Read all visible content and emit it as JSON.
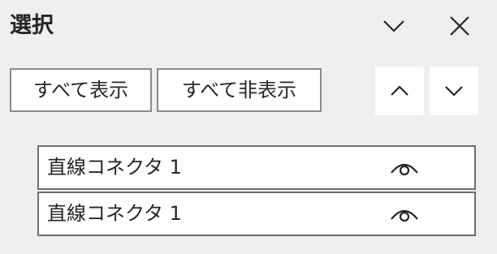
{
  "pane": {
    "title": "選択",
    "options_icon": "chevron-down-icon",
    "close_icon": "close-icon"
  },
  "toolbar": {
    "show_all_label": "すべて表示",
    "hide_all_label": "すべて非表示",
    "bring_forward_icon": "chevron-up-icon",
    "send_backward_icon": "chevron-down-icon"
  },
  "objects": [
    {
      "label": "直線コネクタ 1",
      "visibility_icon": "eye-icon",
      "visible": true
    },
    {
      "label": "直線コネクタ 1",
      "visibility_icon": "eye-icon",
      "visible": true
    }
  ],
  "colors": {
    "pane_background": "#efefef",
    "text": "#262626",
    "button_border": "#8a8a8a",
    "item_border": "#6e6e6e"
  }
}
